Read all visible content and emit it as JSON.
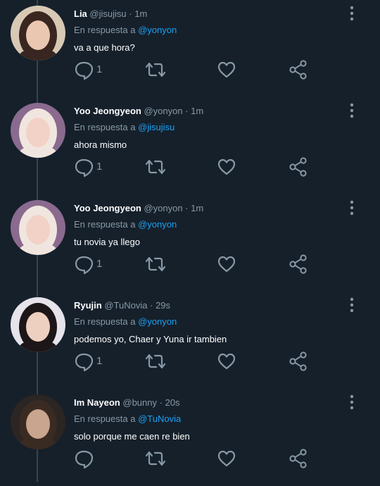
{
  "tweets": [
    {
      "name": "Lia",
      "handle": "@jisujisu",
      "time": "1m",
      "reply_prefix": "En respuesta a",
      "reply_to": "@yonyon",
      "text": "va a que hora?",
      "reply_count": "1",
      "avatar_colors": {
        "bg": "#d8c9b5",
        "hair": "#3a2620",
        "skin": "#e9c7b1"
      }
    },
    {
      "name": "Yoo Jeongyeon",
      "handle": "@yonyon",
      "time": "1m",
      "reply_prefix": "En respuesta a",
      "reply_to": "@jisujisu",
      "text": "ahora mismo",
      "reply_count": "1",
      "avatar_colors": {
        "bg": "#8a6a8e",
        "hair": "#f0e6df",
        "skin": "#f2d2c6"
      }
    },
    {
      "name": "Yoo Jeongyeon",
      "handle": "@yonyon",
      "time": "1m",
      "reply_prefix": "En respuesta a",
      "reply_to": "@yonyon",
      "text": "tu novia ya llego",
      "reply_count": "1",
      "avatar_colors": {
        "bg": "#8a6a8e",
        "hair": "#f0e6df",
        "skin": "#f2d2c6"
      }
    },
    {
      "name": "Ryujin",
      "handle": "@TuNovia",
      "time": "29s",
      "reply_prefix": "En respuesta a",
      "reply_to": "@yonyon",
      "text": "podemos yo, Chaer y Yuna ir tambien",
      "reply_count": "1",
      "avatar_colors": {
        "bg": "#e6e3ea",
        "hair": "#1c1618",
        "skin": "#edd0c0"
      }
    },
    {
      "name": "Im Nayeon",
      "handle": "@bunny",
      "time": "20s",
      "reply_prefix": "En respuesta a",
      "reply_to": "@TuNovia",
      "text": "solo porque me caen re bien",
      "reply_count": "",
      "avatar_colors": {
        "bg": "#2b2523",
        "hair": "#3a2b22",
        "skin": "#c9a48e"
      }
    }
  ],
  "icons": {
    "reply": "reply-icon",
    "retweet": "retweet-icon",
    "like": "heart-icon",
    "share": "share-icon",
    "more": "more-vertical-icon"
  },
  "colors": {
    "background": "#15202b",
    "text": "#ffffff",
    "muted": "#8899a6",
    "link": "#1da1f2"
  }
}
